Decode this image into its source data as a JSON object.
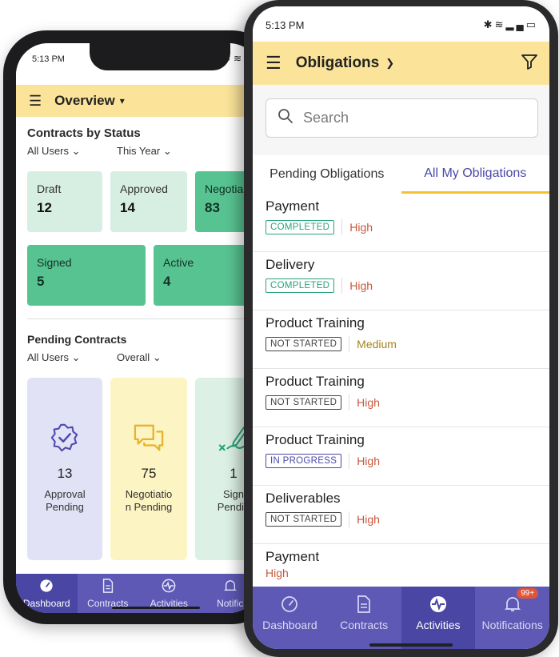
{
  "phone_back": {
    "status_time": "5:13 PM",
    "header": {
      "title": "Overview"
    },
    "contracts_by_status": {
      "title": "Contracts by Status",
      "filter_users": "All Users",
      "filter_period": "This Year",
      "cards": [
        {
          "label": "Draft",
          "value": "12"
        },
        {
          "label": "Approved",
          "value": "14"
        },
        {
          "label": "Negotia",
          "value": "83"
        },
        {
          "label": "Signed",
          "value": "5"
        },
        {
          "label": "Active",
          "value": "4"
        }
      ]
    },
    "pending_contracts": {
      "title": "Pending Contracts",
      "filter_users": "All Users",
      "filter_scope": "Overall",
      "cards": [
        {
          "icon": "approval-badge-icon",
          "value": "13",
          "label_line1": "Approval",
          "label_line2": "Pending"
        },
        {
          "icon": "negotiation-chat-icon",
          "value": "75",
          "label_line1": "Negotiatio",
          "label_line2": "n Pending"
        },
        {
          "icon": "signature-pen-icon",
          "value": "1",
          "label_line1": "Sign",
          "label_line2": "Pendin"
        }
      ]
    },
    "nav": [
      {
        "label": "Dashboard",
        "icon": "dashboard-gauge-icon"
      },
      {
        "label": "Contracts",
        "icon": "document-icon"
      },
      {
        "label": "Activities",
        "icon": "activity-pulse-icon"
      },
      {
        "label": "Notific",
        "icon": "bell-icon"
      }
    ]
  },
  "phone_front": {
    "status_time": "5:13 PM",
    "header": {
      "title": "Obligations"
    },
    "search": {
      "placeholder": "Search"
    },
    "tabs": [
      {
        "label": "Pending Obligations"
      },
      {
        "label": "All My Obligations"
      }
    ],
    "obligations": [
      {
        "name": "Payment",
        "status": "COMPLETED",
        "priority": "High"
      },
      {
        "name": "Delivery",
        "status": "COMPLETED",
        "priority": "High"
      },
      {
        "name": "Product Training",
        "status": "NOT STARTED",
        "priority": "Medium"
      },
      {
        "name": "Product Training",
        "status": "NOT STARTED",
        "priority": "High"
      },
      {
        "name": "Product Training",
        "status": "IN PROGRESS",
        "priority": "High"
      },
      {
        "name": "Deliverables",
        "status": "NOT STARTED",
        "priority": "High"
      },
      {
        "name": "Payment",
        "status": "",
        "priority": "High"
      }
    ],
    "nav": [
      {
        "label": "Dashboard",
        "icon": "dashboard-gauge-icon"
      },
      {
        "label": "Contracts",
        "icon": "document-icon"
      },
      {
        "label": "Activities",
        "icon": "activity-pulse-icon"
      },
      {
        "label": "Notifications",
        "icon": "bell-icon",
        "badge": "99+"
      }
    ]
  }
}
